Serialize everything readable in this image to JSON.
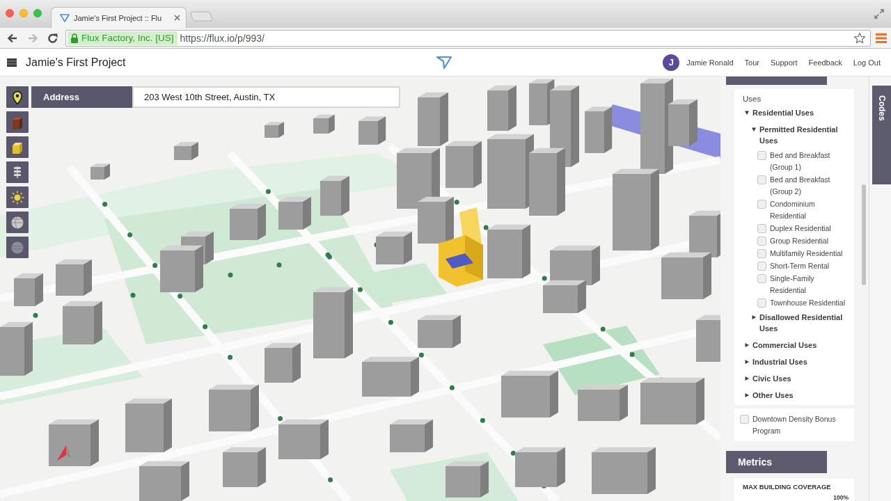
{
  "browser": {
    "tab": {
      "title": "Jamie's First Project :: Flu"
    },
    "nav_buttons": [
      {
        "kind": "back",
        "disabled": false
      },
      {
        "kind": "forward",
        "disabled": true
      },
      {
        "kind": "reload",
        "disabled": false
      }
    ],
    "address_bar": {
      "identity": "Flux Factory, Inc. [US]",
      "url": "https://flux.io/p/993/"
    }
  },
  "app_header": {
    "project_title": "Jamie's First Project",
    "user": {
      "initial": "J",
      "name": "Jamie Ronald"
    },
    "links": [
      "Tour",
      "Support",
      "Feedback",
      "Log Out"
    ]
  },
  "map": {
    "address_search": {
      "label": "Address",
      "value": "203 West 10th Street, Austin, TX"
    }
  },
  "side_panel": {
    "uses": {
      "title": "Uses",
      "items": [
        {
          "kind": "group",
          "label": "Residential Uses",
          "expanded": true,
          "children": [
            {
              "kind": "group",
              "label": "Permitted Residential Uses",
              "expanded": true,
              "children": [
                {
                  "kind": "option",
                  "label": "Bed and Breakfast (Group 1)",
                  "checked": false
                },
                {
                  "kind": "option",
                  "label": "Bed and Breakfast (Group 2)",
                  "checked": false
                },
                {
                  "kind": "option",
                  "label": "Condominium Residential",
                  "checked": false
                },
                {
                  "kind": "option",
                  "label": "Duplex Residential",
                  "checked": false
                },
                {
                  "kind": "option",
                  "label": "Group Residential",
                  "checked": false
                },
                {
                  "kind": "option",
                  "label": "Multifamily Residential",
                  "checked": false
                },
                {
                  "kind": "option",
                  "label": "Short-Term Rental",
                  "checked": false
                },
                {
                  "kind": "option",
                  "label": "Single-Family Residential",
                  "checked": false
                },
                {
                  "kind": "option",
                  "label": "Townhouse Residential",
                  "checked": false
                }
              ]
            },
            {
              "kind": "group",
              "label": "Disallowed Residential Uses",
              "expanded": false
            }
          ]
        },
        {
          "kind": "group",
          "label": "Commercial Uses",
          "expanded": false
        },
        {
          "kind": "group",
          "label": "Industrial Uses",
          "expanded": false
        },
        {
          "kind": "group",
          "label": "Civic Uses",
          "expanded": false
        },
        {
          "kind": "group",
          "label": "Other Uses",
          "expanded": false
        }
      ]
    },
    "density_bonus": {
      "label": "Downtown Density Bonus Program",
      "checked": false
    },
    "metrics": {
      "title": "Metrics",
      "items": [
        {
          "label": "MAX BUILDING COVERAGE",
          "value": "100%"
        }
      ]
    }
  },
  "codes_tab": {
    "label": "Codes"
  }
}
